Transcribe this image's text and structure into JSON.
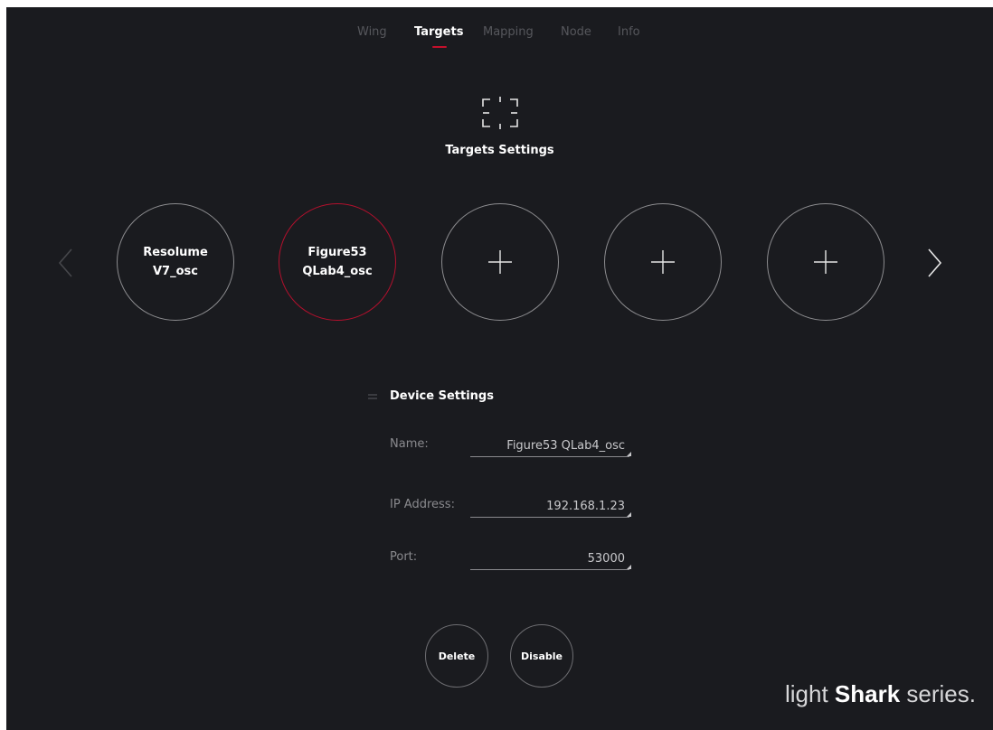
{
  "tabs": [
    {
      "label": "Wing"
    },
    {
      "label": "Targets"
    },
    {
      "label": "Mapping"
    },
    {
      "label": "Node"
    },
    {
      "label": "Info"
    }
  ],
  "active_tab": "Targets",
  "header": {
    "title": "Targets Settings",
    "icon": "target-frame-icon"
  },
  "targets": [
    {
      "line1": "Resolume",
      "line2": "V7_osc"
    },
    {
      "line1": "Figure53",
      "line2": "QLab4_osc",
      "selected": true
    },
    {
      "empty": true,
      "icon": "plus-icon"
    },
    {
      "empty": true,
      "icon": "plus-icon"
    },
    {
      "empty": true,
      "icon": "plus-icon"
    }
  ],
  "device_settings": {
    "title": "Device Settings",
    "name_label": "Name:",
    "name_value": "Figure53 QLab4_osc",
    "ip_label": "IP Address:",
    "ip_value": "192.168.1.23",
    "port_label": "Port:",
    "port_value": "53000"
  },
  "actions": {
    "delete_label": "Delete",
    "disable_label": "Disable"
  },
  "brand": {
    "light": "light ",
    "strong": "Shark",
    "rest": " series."
  },
  "colors": {
    "background": "#1a1b1f",
    "accent": "#c4102b",
    "text": "#ffffff",
    "muted": "#56575c"
  }
}
